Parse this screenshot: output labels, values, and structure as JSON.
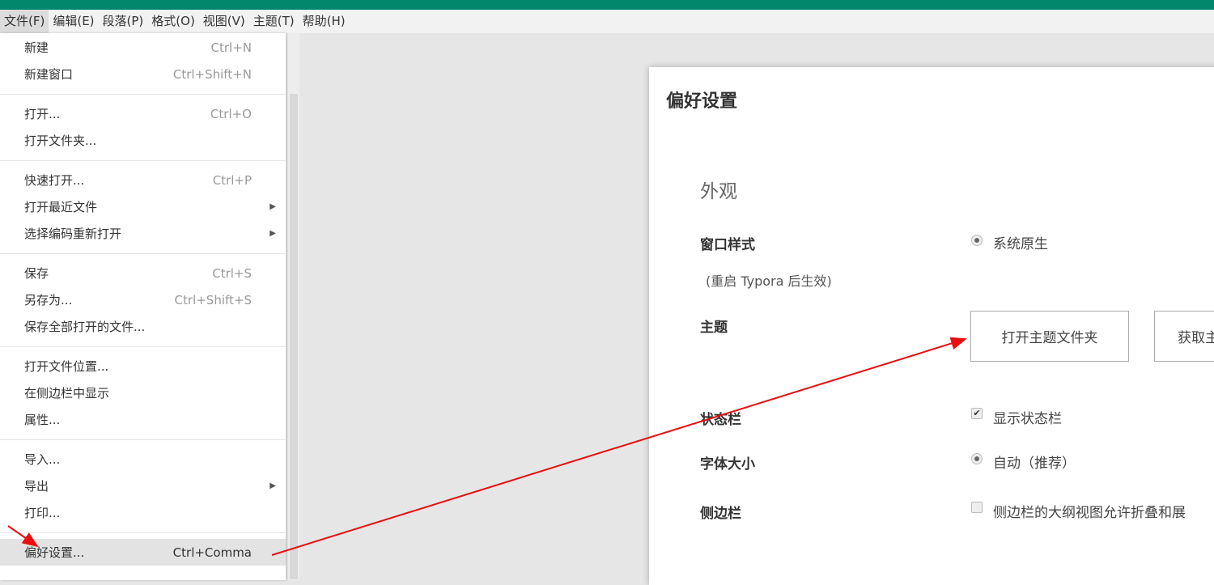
{
  "menubar": [
    "文件(F)",
    "编辑(E)",
    "段落(P)",
    "格式(O)",
    "视图(V)",
    "主题(T)",
    "帮助(H)"
  ],
  "file_menu": [
    {
      "label": "新建",
      "shortcut": "Ctrl+N"
    },
    {
      "label": "新建窗口",
      "shortcut": "Ctrl+Shift+N"
    },
    {
      "label": "打开...",
      "shortcut": "Ctrl+O"
    },
    {
      "label": "打开文件夹...",
      "shortcut": ""
    },
    {
      "label": "快速打开...",
      "shortcut": "Ctrl+P"
    },
    {
      "label": "打开最近文件",
      "shortcut": "",
      "submenu": true
    },
    {
      "label": "选择编码重新打开",
      "shortcut": "",
      "submenu": true
    },
    {
      "label": "保存",
      "shortcut": "Ctrl+S"
    },
    {
      "label": "另存为...",
      "shortcut": "Ctrl+Shift+S"
    },
    {
      "label": "保存全部打开的文件...",
      "shortcut": ""
    },
    {
      "label": "打开文件位置...",
      "shortcut": ""
    },
    {
      "label": "在侧边栏中显示",
      "shortcut": ""
    },
    {
      "label": "属性...",
      "shortcut": ""
    },
    {
      "label": "导入...",
      "shortcut": ""
    },
    {
      "label": "导出",
      "shortcut": "",
      "submenu": true
    },
    {
      "label": "打印...",
      "shortcut": ""
    },
    {
      "label": "偏好设置...",
      "shortcut": "Ctrl+Comma",
      "highlighted": true
    }
  ],
  "prefs": {
    "title": "偏好设置",
    "section": "外观",
    "window_style": {
      "label": "窗口样式",
      "note": "(重启 Typora 后生效)",
      "option": "系统原生",
      "selected": true
    },
    "theme": {
      "label": "主题",
      "open_folder": "打开主题文件夹",
      "get_themes": "获取主"
    },
    "statusbar": {
      "label": "状态栏",
      "option": "显示状态栏",
      "checked": true
    },
    "font_size": {
      "label": "字体大小",
      "option": "自动（推荐）",
      "selected": true
    },
    "sidebar": {
      "label": "侧边栏",
      "option": "侧边栏的大纲视图允许折叠和展",
      "checked": false
    }
  },
  "colors": {
    "titlebar": "#02866c",
    "annotation": "#e81010"
  }
}
